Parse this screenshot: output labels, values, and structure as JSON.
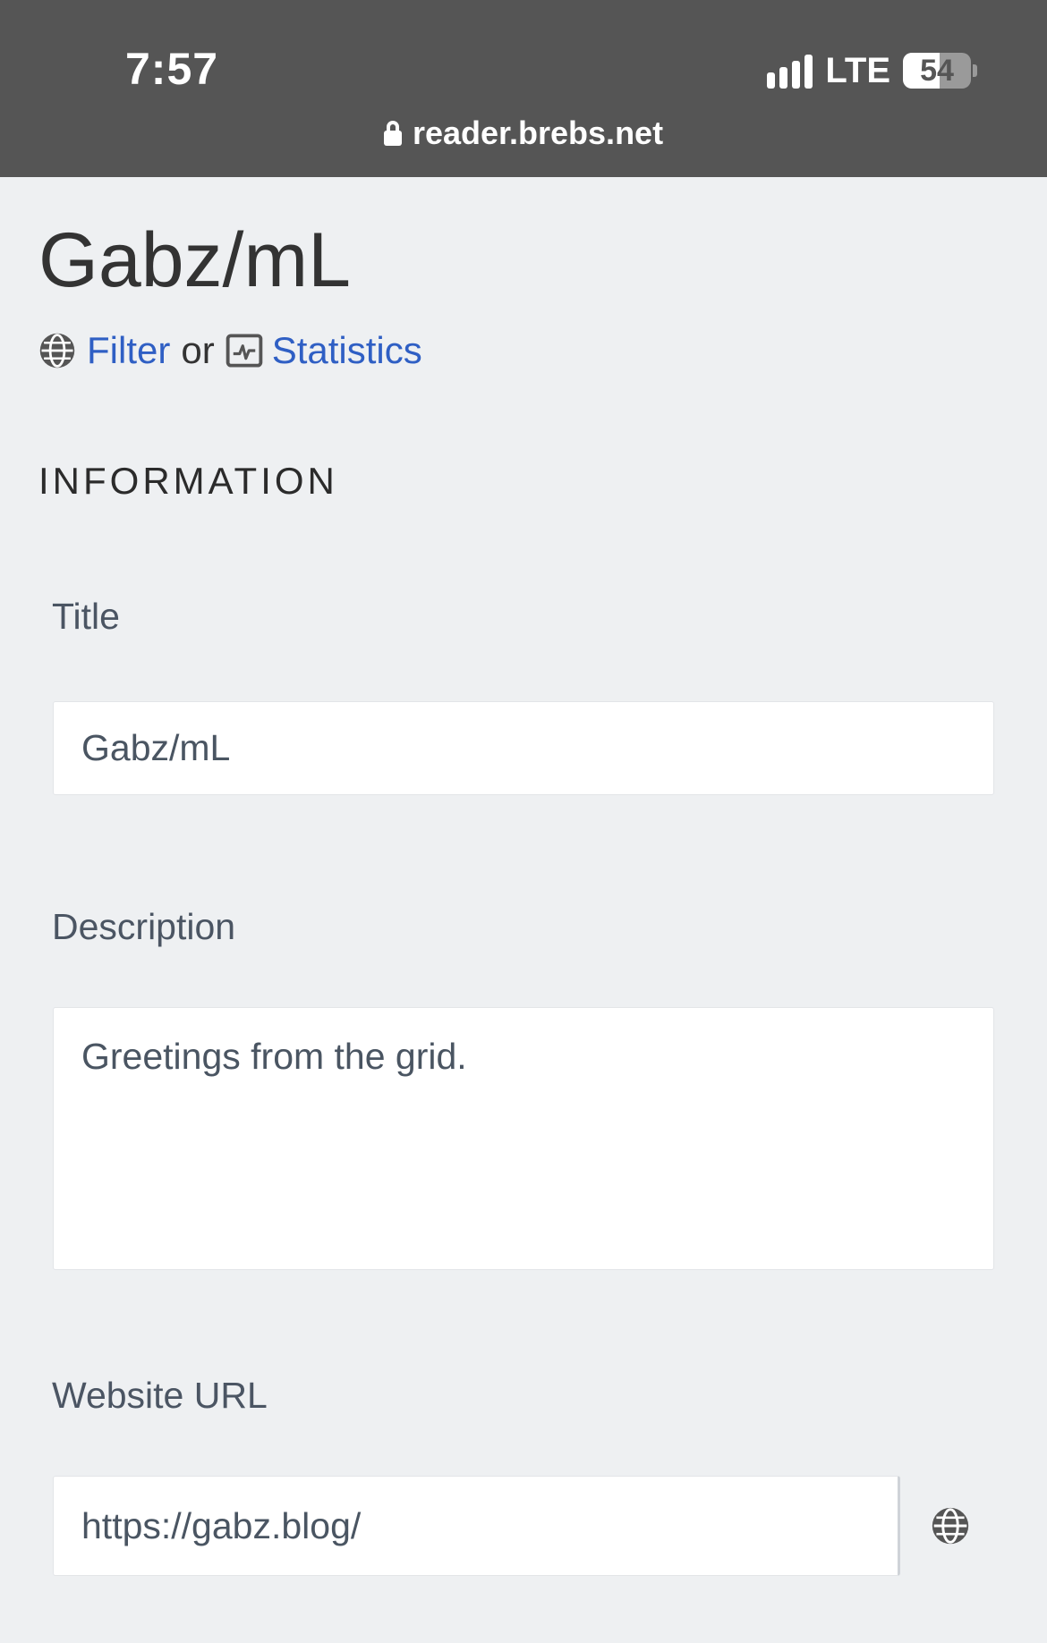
{
  "status_bar": {
    "time": "7:57",
    "network": "LTE",
    "battery_percent": 54,
    "battery_label": "54"
  },
  "browser": {
    "url": "reader.brebs.net"
  },
  "page": {
    "title": "Gabz/mL",
    "links": {
      "filter": "Filter",
      "separator": "or",
      "statistics": "Statistics"
    },
    "section_heading": "INFORMATION"
  },
  "form": {
    "title_label": "Title",
    "title_value": "Gabz/mL",
    "description_label": "Description",
    "description_value": "Greetings from the grid.",
    "website_label": "Website URL",
    "website_value": "https://gabz.blog/"
  },
  "colors": {
    "link": "#2f5fc4",
    "chrome_bg": "#555555",
    "page_bg": "#eef0f2"
  },
  "icons": {
    "filter_link_icon": "globe-icon",
    "statistics_link_icon": "chart-icon",
    "url_action_icon": "globe-icon",
    "url_bar_icon": "lock-icon"
  }
}
